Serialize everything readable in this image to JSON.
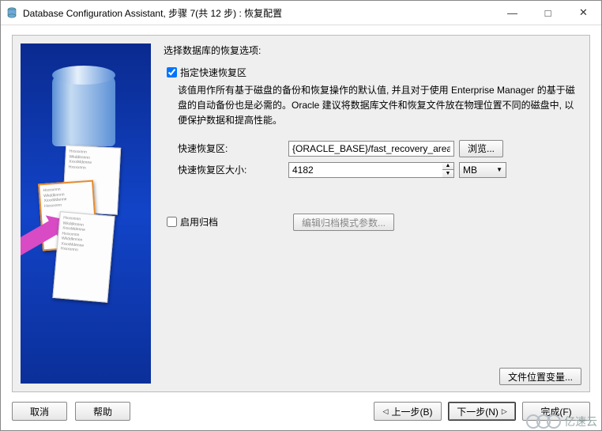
{
  "window": {
    "title": "Database Configuration Assistant, 步骤 7(共 12 步) : 恢复配置"
  },
  "form": {
    "prompt": "选择数据库的恢复选项:",
    "specify_fra_label": "指定快速恢复区",
    "desc": "该值用作所有基于磁盘的备份和恢复操作的默认值, 并且对于使用 Enterprise Manager 的基于磁盘的自动备份也是必需的。Oracle 建议将数据库文件和恢复文件放在物理位置不同的磁盘中, 以便保护数据和提高性能。",
    "fra_label": "快速恢复区:",
    "fra_value": "{ORACLE_BASE}/fast_recovery_area",
    "browse": "浏览...",
    "fra_size_label": "快速恢复区大小:",
    "fra_size_value": "4182",
    "unit": "MB",
    "enable_arch_label": "启用归档",
    "edit_arch_btn": "编辑归档模式参数...",
    "var_btn": "文件位置变量..."
  },
  "buttons": {
    "cancel": "取消",
    "help": "帮助",
    "back": "上一步(B)",
    "next": "下一步(N)",
    "finish": "完成(F)"
  },
  "watermark": "亿速云"
}
